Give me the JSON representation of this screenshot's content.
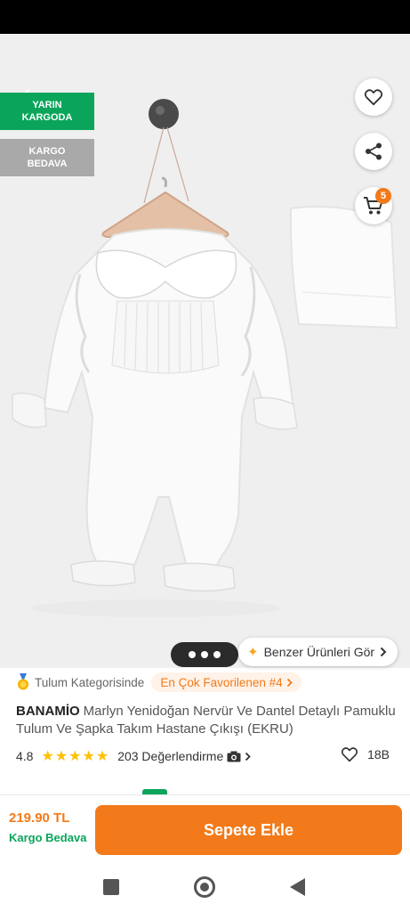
{
  "badges": {
    "next_day": "YARIN\nKARGODA",
    "next_day_line1": "YARIN",
    "next_day_line2": "KARGODA",
    "free_line1": "KARGO",
    "free_line2": "BEDAVA"
  },
  "gallery": {
    "cart_count": "5",
    "similar_label": "Benzer Ürünleri Gör",
    "dot_count": 3
  },
  "category": {
    "label": "Tulum Kategorisinde",
    "rank_label": "En Çok Favorilenen #4"
  },
  "product": {
    "brand": "BANAMİO",
    "name": "Marlyn Yenidoğan Nervür Ve Dantel Detaylı Pamuklu Tulum Ve Şapka Takım Hastane Çıkışı (EKRU)",
    "rating": "4.8",
    "stars": 5,
    "reviews_label": "203 Değerlendirme",
    "favorites": "18B"
  },
  "purchase": {
    "price": "219.90 TL",
    "shipping": "Kargo Bedava",
    "add_to_cart": "Sepete Ekle"
  },
  "colors": {
    "brand_orange": "#f27a1a",
    "green": "#0aa55a",
    "star": "#ffc000"
  },
  "icons": [
    "back-arrow-icon",
    "heart-icon",
    "share-icon",
    "cart-icon",
    "sparkle-icon",
    "medal-icon",
    "star-icon",
    "camera-icon",
    "chevron-right-icon",
    "nav-recents-icon",
    "nav-home-icon",
    "nav-back-icon"
  ]
}
